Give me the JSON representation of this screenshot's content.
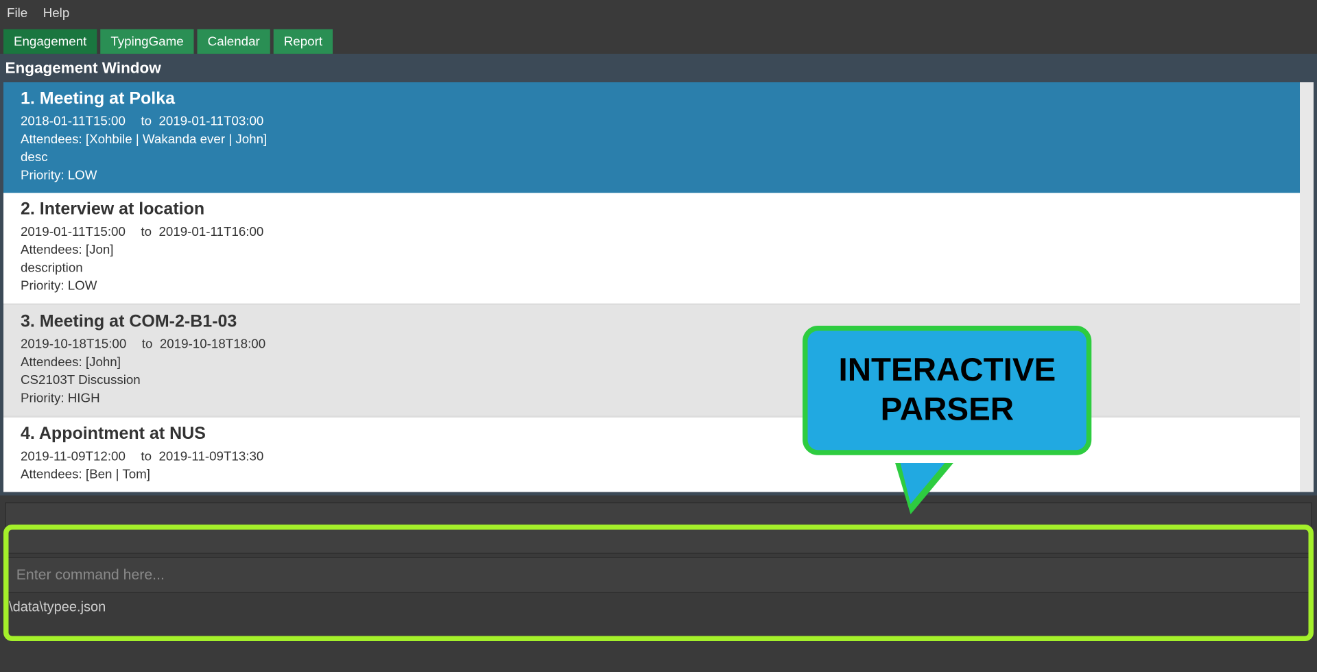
{
  "menu": {
    "file": "File",
    "help": "Help"
  },
  "tabs": [
    {
      "label": "Engagement",
      "active": true
    },
    {
      "label": "TypingGame",
      "active": false
    },
    {
      "label": "Calendar",
      "active": false
    },
    {
      "label": "Report",
      "active": false
    }
  ],
  "window_title": "Engagement Window",
  "engagements": [
    {
      "title": "1. Meeting at Polka",
      "start": "2018-01-11T15:00",
      "end": "2019-01-11T03:00",
      "attendees": "Attendees: [Xohbile | Wakanda ever | John]",
      "description": "desc",
      "priority": "Priority: LOW",
      "selected": true,
      "alt": false
    },
    {
      "title": "2. Interview at location",
      "start": "2019-01-11T15:00",
      "end": "2019-01-11T16:00",
      "attendees": "Attendees: [Jon]",
      "description": "description",
      "priority": "Priority: LOW",
      "selected": false,
      "alt": false
    },
    {
      "title": "3. Meeting at COM-2-B1-03",
      "start": "2019-10-18T15:00",
      "end": "2019-10-18T18:00",
      "attendees": "Attendees: [John]",
      "description": "CS2103T Discussion",
      "priority": "Priority: HIGH",
      "selected": false,
      "alt": true
    },
    {
      "title": "4. Appointment at NUS",
      "start": "2019-11-09T12:00",
      "end": "2019-11-09T13:30",
      "attendees": "Attendees: [Ben | Tom]",
      "description": "",
      "priority": "",
      "selected": false,
      "alt": false
    }
  ],
  "to_label": "to",
  "callout": "INTERACTIVE\nPARSER",
  "command_placeholder": "Enter command here...",
  "status_path": ".\\data\\typee.json",
  "colors": {
    "tab_green": "#2a8f54",
    "tab_green_active": "#1a763f",
    "selected_blue": "#2b7fac",
    "callout_blue": "#21a9e1",
    "callout_border": "#2ecc40",
    "highlight": "#a4f02a"
  }
}
